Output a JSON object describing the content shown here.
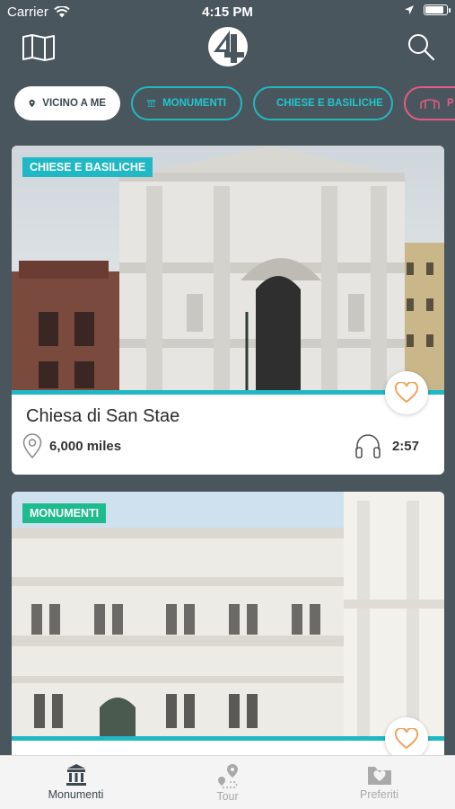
{
  "status_bar": {
    "carrier": "Carrier",
    "time": "4:15 PM",
    "battery_level": 0.9
  },
  "header": {
    "map_icon": "map-icon",
    "logo_icon": "app-logo-icon",
    "search_icon": "search-icon"
  },
  "filters": [
    {
      "label": "VICINO A ME",
      "icon": "location-pin-icon",
      "active": true
    },
    {
      "label": "MONUMENTI",
      "icon": "monument-icon",
      "active": false
    },
    {
      "label": "CHIESE E BASILICHE",
      "icon": "church-icon",
      "active": false
    },
    {
      "label": "P",
      "icon": "bridge-icon",
      "active": false
    }
  ],
  "cards": [
    {
      "category": "CHIESE E BASILICHE",
      "title": "Chiesa di San Stae",
      "distance": "6,000 miles",
      "duration": "2:57"
    },
    {
      "category": "MONUMENTI"
    }
  ],
  "tabs": [
    {
      "label": "Monumenti",
      "icon": "monument-icon",
      "active": true
    },
    {
      "label": "Tour",
      "icon": "tour-route-icon",
      "active": false
    },
    {
      "label": "Preferiti",
      "icon": "favorites-folder-icon",
      "active": false
    }
  ],
  "colors": {
    "background": "#4a565e",
    "accent": "#1fb8c4",
    "monument_badge": "#1ebb8c",
    "pink": "#e75b84",
    "heart": "#f0a35c"
  }
}
